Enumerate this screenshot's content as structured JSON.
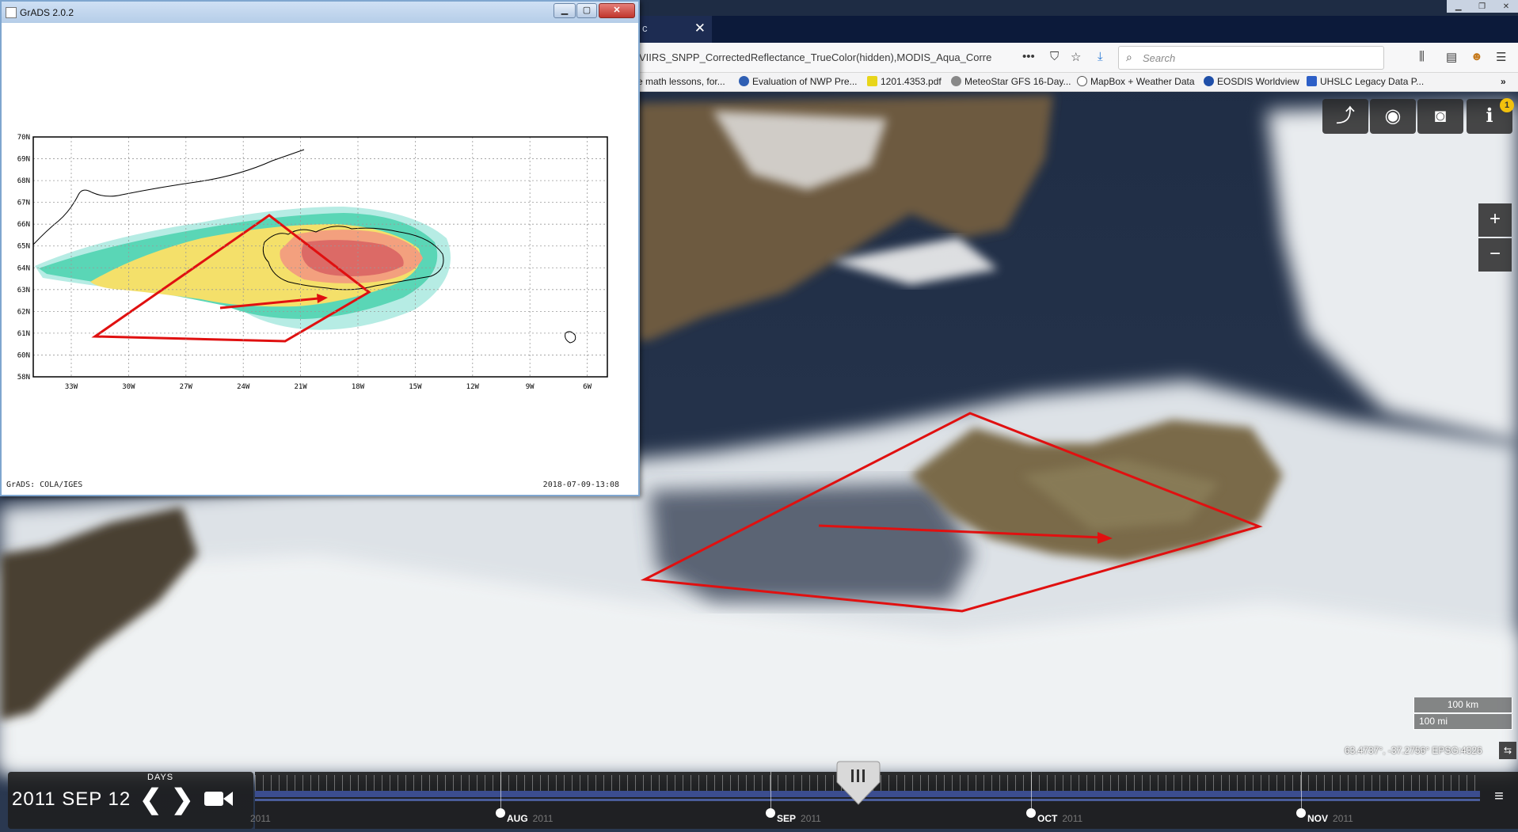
{
  "browser": {
    "tab_title": "c",
    "url": "VIIRS_SNPP_CorrectedReflectance_TrueColor(hidden),MODIS_Aqua_Corre",
    "search_placeholder": "Search",
    "bookmarks": [
      {
        "label": "e math lessons, for...",
        "color": "#ffffff"
      },
      {
        "label": "Evaluation of NWP Pre...",
        "color": "#2f5fb3"
      },
      {
        "label": "1201.4353.pdf",
        "color": "#e8d51a"
      },
      {
        "label": "MeteoStar GFS 16-Day...",
        "color": "#888888"
      },
      {
        "label": "MapBox + Weather Data",
        "color": "#555555"
      },
      {
        "label": "EOSDIS Worldview",
        "color": "#1f4fa8"
      },
      {
        "label": "UHSLC Legacy Data P...",
        "color": "#2d5fc7"
      }
    ]
  },
  "worldview": {
    "notification_count": "1",
    "zoom_in": "+",
    "zoom_out": "−",
    "scale_km": "100 km",
    "scale_mi": "100 mi",
    "coordinates": "63.4737°, -37.2756° EPSG:4326",
    "days_label": "DAYS",
    "date": "2011 SEP 12",
    "months": [
      {
        "label": "AUG",
        "year": "2011"
      },
      {
        "label": "SEP",
        "year": "2011"
      },
      {
        "label": "OCT",
        "year": "2011"
      },
      {
        "label": "NOV",
        "year": "2011"
      }
    ],
    "year_start": "2011"
  },
  "grads": {
    "title": "GrADS 2.0.2",
    "footer_left": "GrADS: COLA/IGES",
    "footer_right": "2018-07-09-13:08",
    "lat_labels": [
      "70N",
      "69N",
      "68N",
      "67N",
      "66N",
      "65N",
      "64N",
      "63N",
      "62N",
      "61N",
      "60N",
      "58N"
    ],
    "lon_labels": [
      "33W",
      "30W",
      "27W",
      "24W",
      "21W",
      "18W",
      "15W",
      "12W",
      "9W",
      "6W"
    ],
    "colors": {
      "light_cyan": "#b6ece4",
      "teal": "#5ad6b6",
      "yellow": "#f4e06a",
      "salmon": "#f3a07e",
      "red": "#dc6a66",
      "polygon": "#e01010"
    }
  }
}
